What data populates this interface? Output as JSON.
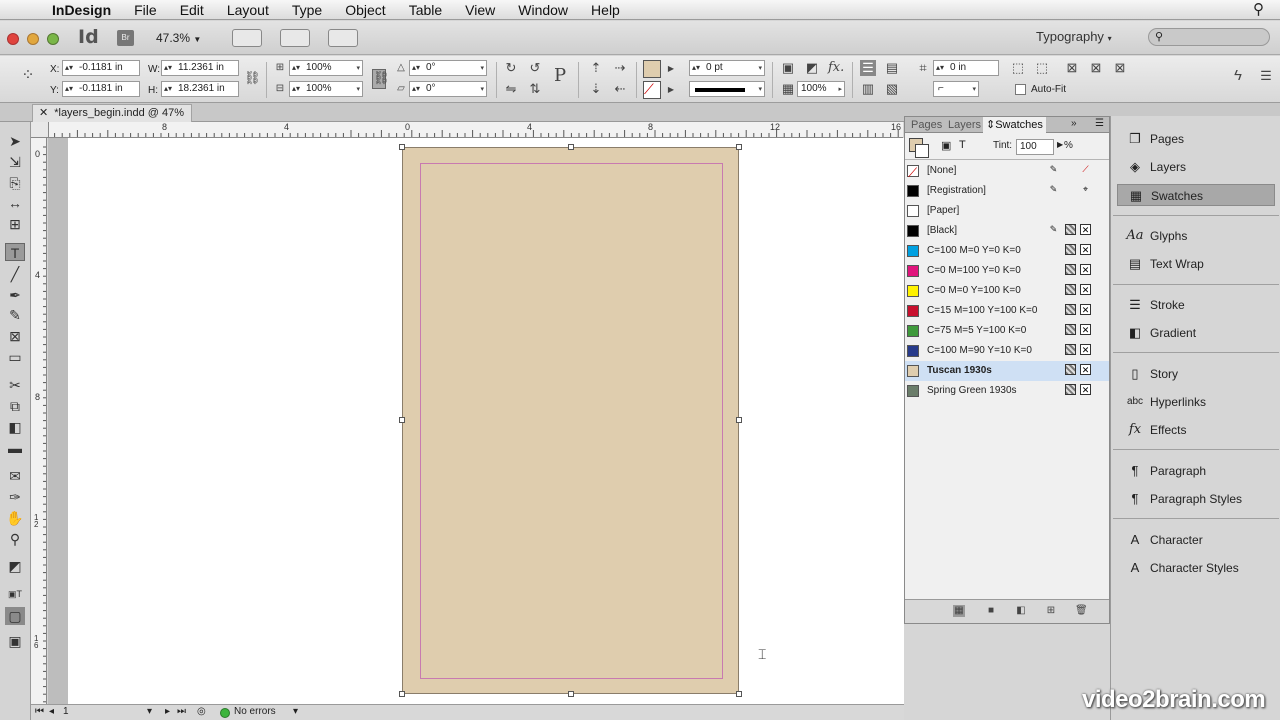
{
  "menubar": {
    "app": "InDesign",
    "items": [
      "File",
      "Edit",
      "Layout",
      "Type",
      "Object",
      "Table",
      "View",
      "Window",
      "Help"
    ]
  },
  "appbar": {
    "logo": "Id",
    "bridge": "Br",
    "zoom": "47.3%",
    "workspace": "Typography"
  },
  "control": {
    "x_label": "X:",
    "x_value": "-0.1181 in",
    "y_label": "Y:",
    "y_value": "-0.1181 in",
    "w_label": "W:",
    "w_value": "11.2361 in",
    "h_label": "H:",
    "h_value": "18.2361 in",
    "scale_x": "100%",
    "scale_y": "100%",
    "rotate": "0°",
    "shear": "0°",
    "stroke_weight": "0 pt",
    "opacity": "100%",
    "offset": "0 in",
    "autofit": "Auto-Fit"
  },
  "document": {
    "tab_title": "*layers_begin.indd @ 47%"
  },
  "hruler": [
    "8",
    "4",
    "0",
    "4",
    "8",
    "12",
    "16"
  ],
  "vruler": [
    "0",
    "4",
    "8",
    "1 2",
    "1 6"
  ],
  "status": {
    "page": "1",
    "preflight": "No errors"
  },
  "swatches_panel": {
    "tabs": [
      "Pages",
      "Layers",
      "Swatches"
    ],
    "tint_label": "Tint:",
    "tint_value": "100",
    "tint_unit": "%",
    "rows": [
      {
        "name": "[None]",
        "color": "#ffffff",
        "selected": false
      },
      {
        "name": "[Registration]",
        "color": "#000000",
        "selected": false
      },
      {
        "name": "[Paper]",
        "color": "#ffffff",
        "selected": false
      },
      {
        "name": "[Black]",
        "color": "#000000",
        "selected": false
      },
      {
        "name": "C=100 M=0 Y=0 K=0",
        "color": "#00a0e0",
        "selected": false
      },
      {
        "name": "C=0 M=100 Y=0 K=0",
        "color": "#e0147c",
        "selected": false
      },
      {
        "name": "C=0 M=0 Y=100 K=0",
        "color": "#fff200",
        "selected": false
      },
      {
        "name": "C=15 M=100 Y=100 K=0",
        "color": "#c8102e",
        "selected": false
      },
      {
        "name": "C=75 M=5 Y=100 K=0",
        "color": "#3f9a3c",
        "selected": false
      },
      {
        "name": "C=100 M=90 Y=10 K=0",
        "color": "#273a8a",
        "selected": false
      },
      {
        "name": "Tuscan 1930s",
        "color": "#dfcdae",
        "selected": true
      },
      {
        "name": "Spring Green 1930s",
        "color": "#6b7d6a",
        "selected": false
      }
    ]
  },
  "dock": {
    "items": [
      "Pages",
      "Layers",
      "Swatches",
      "Glyphs",
      "Text Wrap",
      "Stroke",
      "Gradient",
      "Story",
      "Hyperlinks",
      "Effects",
      "Paragraph",
      "Paragraph Styles",
      "Character",
      "Character Styles"
    ]
  },
  "watermark": "video2brain.com",
  "colors": {
    "page_fill": "#dfcdae",
    "margin_guide": "#c87ab0",
    "selection": "#cfe0f4"
  }
}
